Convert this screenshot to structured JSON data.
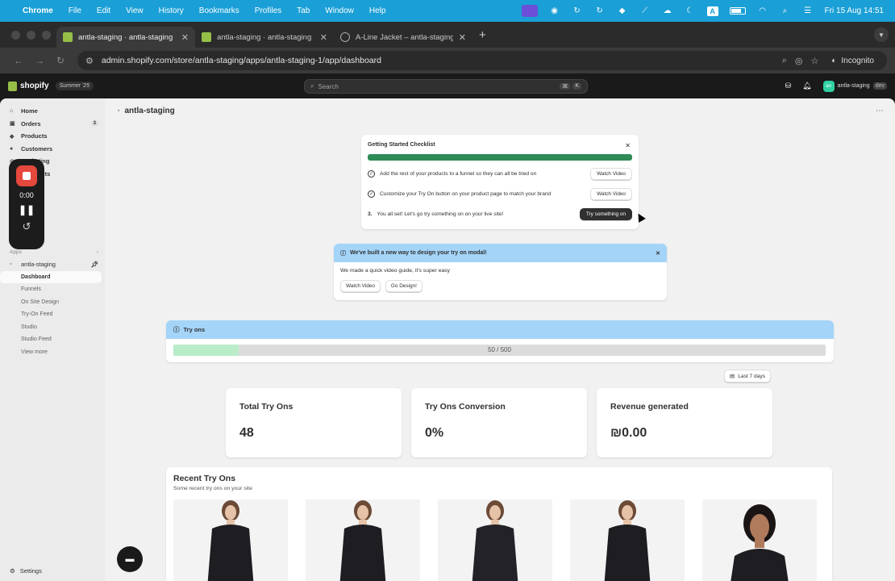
{
  "menubar": {
    "app": "Chrome",
    "items": [
      "File",
      "Edit",
      "View",
      "History",
      "Bookmarks",
      "Profiles",
      "Tab",
      "Window",
      "Help"
    ],
    "input_badge": "A",
    "clock": "Fri 15 Aug  14:51"
  },
  "tabs": [
    {
      "label": "antla-staging · antla-staging",
      "icon": "shopify-icon"
    },
    {
      "label": "antla-staging · antla-staging",
      "icon": "shopify-icon"
    },
    {
      "label": "A-Line Jacket – antla-staging",
      "icon": "globe-icon"
    }
  ],
  "toolbar": {
    "url": "admin.shopify.com/store/antla-staging/apps/antla-staging-1/app/dashboard",
    "incognito": "Incognito"
  },
  "shopify": {
    "logo": "shopify",
    "edition": "Summer '25",
    "search_placeholder": "Search",
    "kbd": [
      "⌘",
      "K"
    ],
    "store_name": "antla-staging",
    "store_avatar": "an",
    "store_badge": "dev"
  },
  "sidebar": {
    "items": [
      {
        "label": "Home",
        "icon": "home-icon"
      },
      {
        "label": "Orders",
        "icon": "orders-icon",
        "count": "3"
      },
      {
        "label": "Products",
        "icon": "tag-icon"
      },
      {
        "label": "Customers",
        "icon": "person-icon"
      },
      {
        "label": "Marketing",
        "icon": "target-icon"
      },
      {
        "label": "Discounts",
        "icon": "discount-icon"
      }
    ],
    "apps_heading": "Apps",
    "app_name": "antla-staging",
    "app_pages": [
      "Dashboard",
      "Funnels",
      "On Site Design",
      "Try-On Feed",
      "Studio",
      "Studio Feed",
      "View more"
    ],
    "settings": "Settings"
  },
  "recorder": {
    "time": "0:00"
  },
  "page": {
    "title": "antla-staging"
  },
  "checklist": {
    "title": "Getting Started Checklist",
    "steps": [
      {
        "marker": "✓",
        "text": "Add the rest of your products to a funnel so they can all be tried on",
        "button": "Watch Video"
      },
      {
        "marker": "✓",
        "text": "Customize your Try On button on your product page to match your brand",
        "button": "Watch Video"
      },
      {
        "marker": "3.",
        "text": "You all set! Let's go try something on on your live site!",
        "button": "Try something on"
      }
    ]
  },
  "banner": {
    "title": "We've built a new way to design your try on modal!",
    "body": "We made a quick video guide, it's super easy",
    "buttons": [
      "Watch Video",
      "Go Design!"
    ]
  },
  "tryons": {
    "title": "Try ons",
    "used": 50,
    "limit": 500,
    "progress_label": "50 / 500"
  },
  "date_range": "Last 7 days",
  "stats": [
    {
      "label": "Total Try Ons",
      "value": "48"
    },
    {
      "label": "Try Ons Conversion",
      "value": "0%"
    },
    {
      "label": "Revenue generated",
      "value": "₪0.00"
    }
  ],
  "recent": {
    "title": "Recent Try Ons",
    "subtitle": "Some recent try ons on your site"
  },
  "colors": {
    "accent_green": "#2e8b57",
    "info_blue": "#a4d4f8",
    "progress_green": "#b9ecc9",
    "record_red": "#e5483d"
  }
}
